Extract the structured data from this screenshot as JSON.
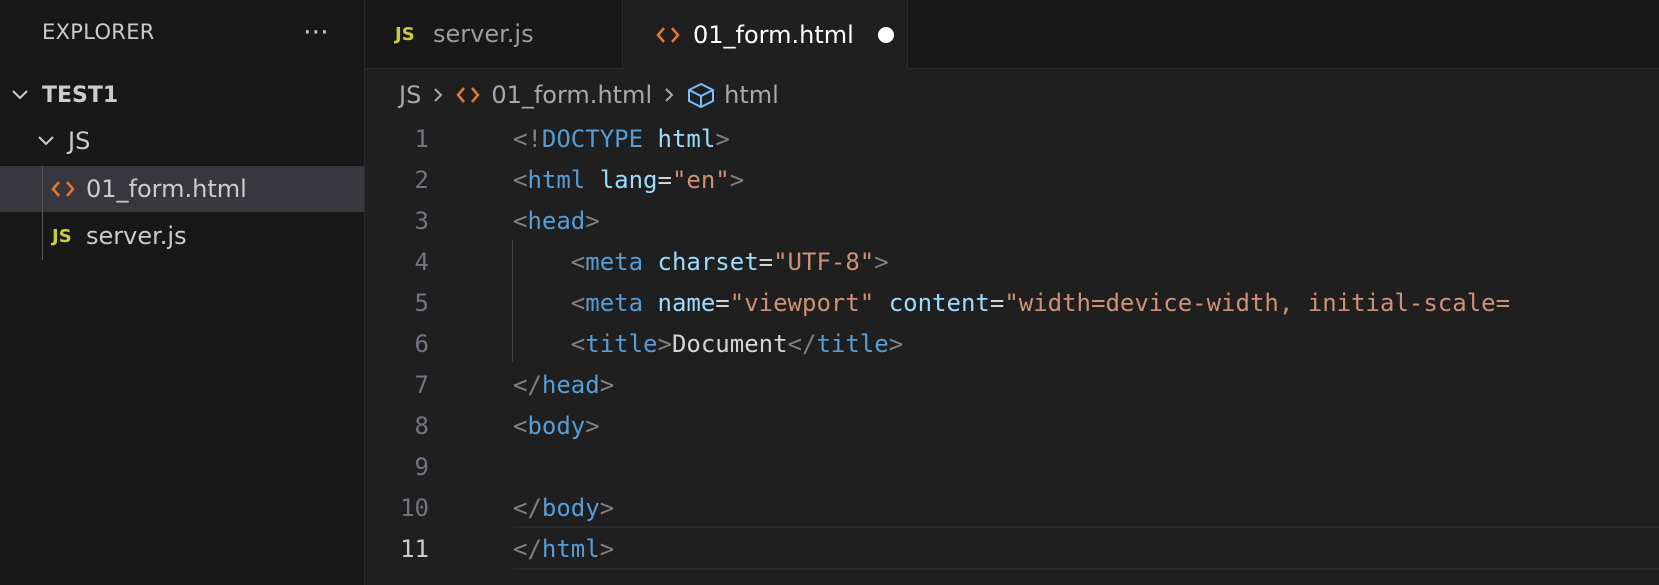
{
  "explorer": {
    "title": "EXPLORER",
    "more_icon": "ellipsis-icon",
    "root": "TEST1",
    "folder": "JS",
    "files": [
      {
        "name": "01_form.html",
        "icon": "html-file-icon",
        "selected": true
      },
      {
        "name": "server.js",
        "icon": "js-file-icon",
        "badge": "JS",
        "selected": false
      }
    ]
  },
  "tabs": [
    {
      "label": "server.js",
      "badge": "JS",
      "active": false
    },
    {
      "label": "01_form.html",
      "active": true,
      "dirty": true
    }
  ],
  "breadcrumb": {
    "folder": "JS",
    "file": "01_form.html",
    "symbol": "html"
  },
  "editor": {
    "current_line": 11,
    "line_numbers": [
      "1",
      "2",
      "3",
      "4",
      "5",
      "6",
      "7",
      "8",
      "9",
      "10",
      "11"
    ],
    "lines": {
      "l1": [
        "<!",
        "DOCTYPE",
        " ",
        "html",
        ">"
      ],
      "l2": [
        "<",
        "html",
        " ",
        "lang",
        "=",
        "\"en\"",
        ">"
      ],
      "l3": [
        "<",
        "head",
        ">"
      ],
      "l4": [
        "    <",
        "meta",
        " ",
        "charset",
        "=",
        "\"UTF-8\"",
        ">"
      ],
      "l5": [
        "    <",
        "meta",
        " ",
        "name",
        "=",
        "\"viewport\"",
        " ",
        "content",
        "=",
        "\"width=device-width, initial-scale="
      ],
      "l6": [
        "    <",
        "title",
        ">",
        "Document",
        "</",
        "title",
        ">"
      ],
      "l7": [
        "</",
        "head",
        ">"
      ],
      "l8": [
        "<",
        "body",
        ">"
      ],
      "l10": [
        "</",
        "body",
        ">"
      ],
      "l11": [
        "</",
        "html",
        ">"
      ]
    }
  },
  "colors": {
    "tag": "#569cd6",
    "attribute": "#9cdcfe",
    "string": "#ce9178",
    "punctuation": "#808080",
    "html_icon": "#e37933",
    "js_icon": "#cbcb41"
  }
}
